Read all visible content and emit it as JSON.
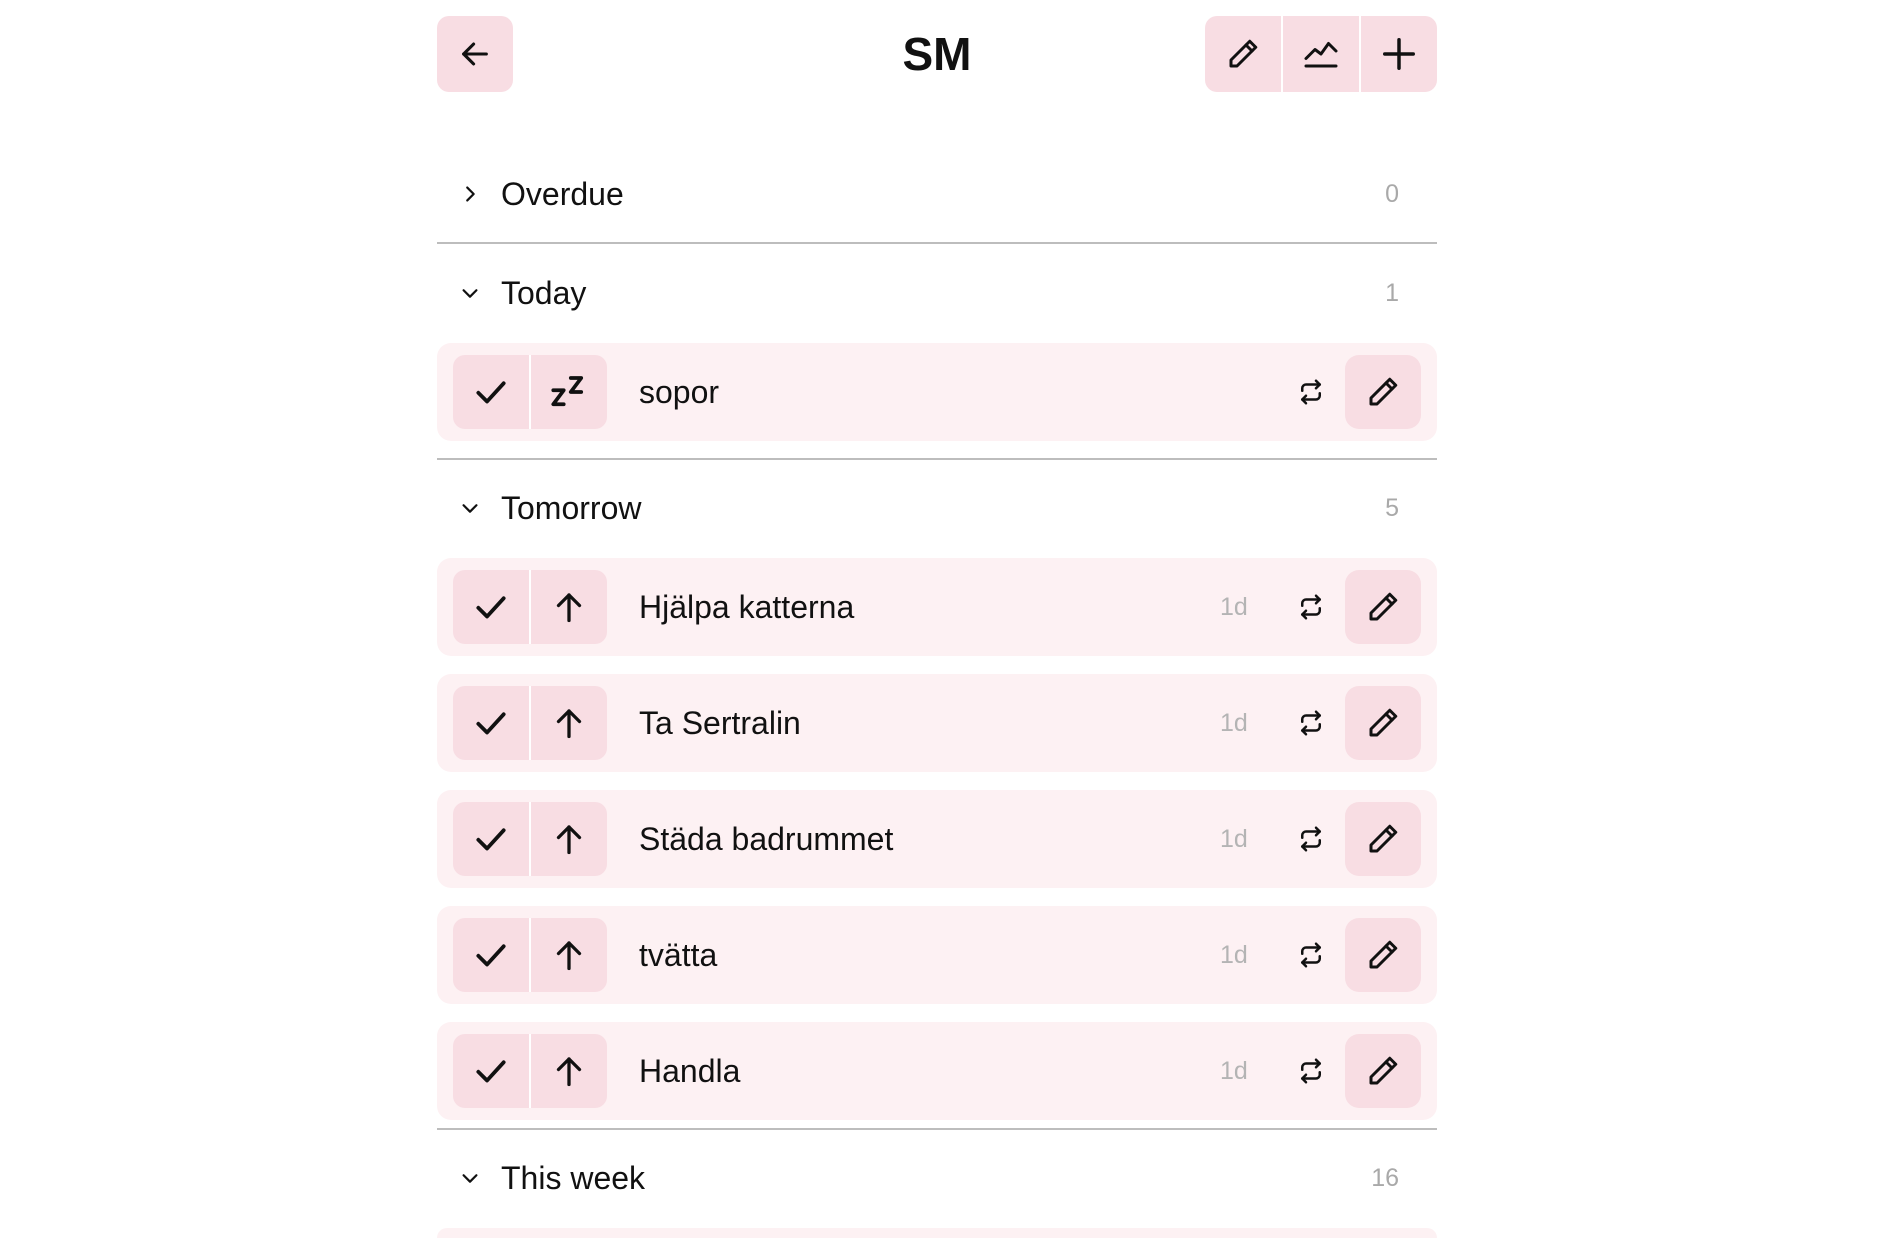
{
  "header": {
    "title": "SM",
    "back_icon": "arrow-left-icon",
    "toolbar_icons": [
      "pencil-icon",
      "chart-line-icon",
      "plus-icon"
    ]
  },
  "colors": {
    "button_pink": "#f8dde3",
    "row_background": "#fdf1f3",
    "count_gray": "#a9a9a9",
    "divider": "#bdbdbd"
  },
  "sections": {
    "overdue": {
      "label": "Overdue",
      "count": "0",
      "expanded": false
    },
    "today": {
      "label": "Today",
      "count": "1",
      "expanded": true,
      "tasks": [
        {
          "name": "sopor",
          "days": "",
          "second_action": "snooze-icon"
        }
      ]
    },
    "tomorrow": {
      "label": "Tomorrow",
      "count": "5",
      "expanded": true,
      "tasks": [
        {
          "name": "Hjälpa katterna",
          "days": "1d",
          "second_action": "arrow-up-icon"
        },
        {
          "name": "Ta Sertralin",
          "days": "1d",
          "second_action": "arrow-up-icon"
        },
        {
          "name": "Städa badrummet",
          "days": "1d",
          "second_action": "arrow-up-icon"
        },
        {
          "name": "tvätta",
          "days": "1d",
          "second_action": "arrow-up-icon"
        },
        {
          "name": "Handla",
          "days": "1d",
          "second_action": "arrow-up-icon"
        }
      ]
    },
    "this_week": {
      "label": "This week",
      "count": "16",
      "expanded": true
    }
  }
}
